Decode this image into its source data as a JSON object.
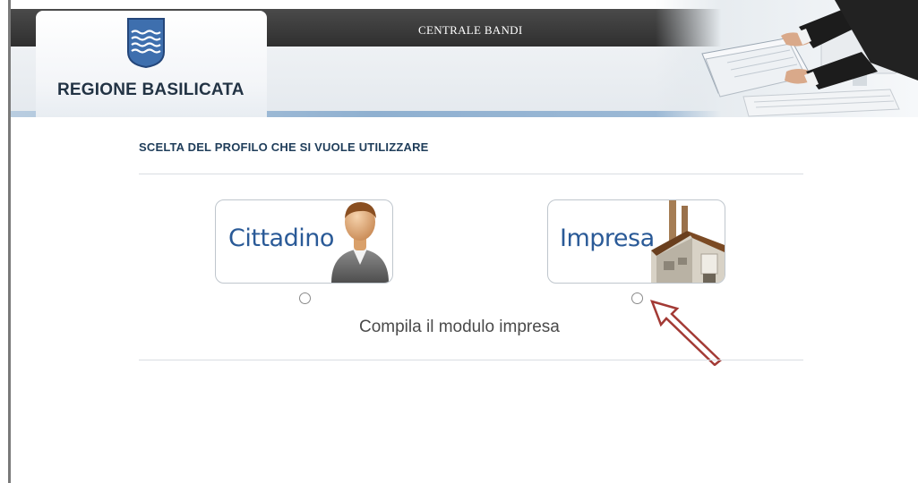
{
  "header": {
    "logo_text": "REGIONE BASILICATA",
    "central_title": "CENTRALE BANDI",
    "emblem_icon": "region-emblem-icon",
    "photo_icon": "hands-documents-computer-icon"
  },
  "main": {
    "section_title": "SCELTA DEL PROFILO CHE SI VUOLE UTILIZZARE",
    "profiles": [
      {
        "label": "Cittadino",
        "icon": "person-avatar-icon",
        "selected": false
      },
      {
        "label": "Impresa",
        "icon": "factory-building-icon",
        "selected": false
      }
    ],
    "instruction": "Compila il modulo impresa",
    "annotation_icon": "outline-arrow-icon"
  },
  "colors": {
    "title_text": "#1f3d5a",
    "card_label": "#2a5a97",
    "arrow": "#a33a35",
    "topbar": "#3a3a3a"
  }
}
